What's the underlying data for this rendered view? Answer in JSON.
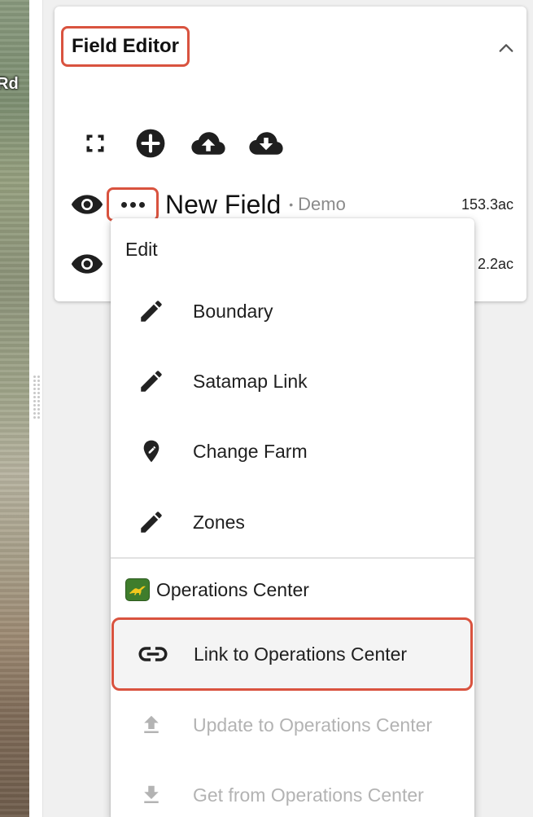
{
  "map": {
    "road_label": "Rd"
  },
  "card": {
    "title": "Field Editor",
    "toolbar": [
      {
        "icon": "fit-bounds-icon"
      },
      {
        "icon": "add-circle-icon"
      },
      {
        "icon": "cloud-upload-icon"
      },
      {
        "icon": "cloud-download-icon"
      }
    ],
    "fields": [
      {
        "name": "New Field",
        "separator": "•",
        "farm": "Demo",
        "area": "153.3ac"
      },
      {
        "name": "",
        "farm": "",
        "area": "2.2ac"
      }
    ]
  },
  "menu": {
    "header": "Edit",
    "items": [
      {
        "label": "Boundary",
        "icon": "pencil-icon"
      },
      {
        "label": "Satamap Link",
        "icon": "pencil-icon"
      },
      {
        "label": "Change Farm",
        "icon": "map-pin-icon"
      },
      {
        "label": "Zones",
        "icon": "pencil-icon"
      }
    ],
    "oc_header": "Operations Center",
    "oc_items": [
      {
        "label": "Link to Operations Center",
        "icon": "link-icon"
      },
      {
        "label": "Update to Operations Center",
        "icon": "upload-icon"
      },
      {
        "label": "Get from Operations Center",
        "icon": "download-icon"
      }
    ]
  },
  "colors": {
    "highlight_border": "#d9533f",
    "disabled_text": "#b3b3b3",
    "john_deere_green": "#3f7d2c",
    "john_deere_yellow": "#f2c81d"
  }
}
